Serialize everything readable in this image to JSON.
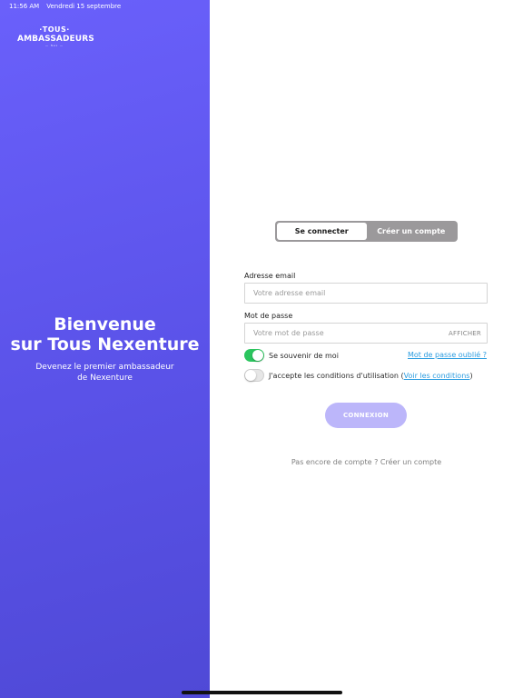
{
  "status_bar": {
    "time": "11:56 AM",
    "date": "Vendredi 15 septembre"
  },
  "logo": {
    "top": "TOUS",
    "main": "AMBASSADEURS",
    "sub": "Nex"
  },
  "welcome": {
    "title_line1": "Bienvenue",
    "title_line2": "sur Tous Nexenture",
    "subtitle_line1": "Devenez le premier ambassadeur",
    "subtitle_line2": "de Nexenture"
  },
  "tabs": {
    "login": "Se connecter",
    "signup": "Créer un compte",
    "active": "login"
  },
  "email": {
    "label": "Adresse email",
    "placeholder": "Votre adresse email",
    "value": ""
  },
  "password": {
    "label": "Mot de passe",
    "placeholder": "Votre mot de passe",
    "value": "",
    "show_label": "AFFICHER"
  },
  "remember": {
    "label": "Se souvenir de moi",
    "enabled": true
  },
  "forgot_password": "Mot de passe oublié ?",
  "terms": {
    "label": "J'accepte les conditions d'utilisation (",
    "link": "Voir les conditions",
    "close": ")",
    "enabled": false
  },
  "submit_label": "CONNEXION",
  "signup_prompt": "Pas encore de compte ? Créer un compte",
  "colors": {
    "brand_purple": "#6a60fb",
    "toggle_on": "#2bc55e",
    "link": "#2b9ce0",
    "button_disabled": "#bcb6fa",
    "tab_bg": "#9b999b"
  }
}
